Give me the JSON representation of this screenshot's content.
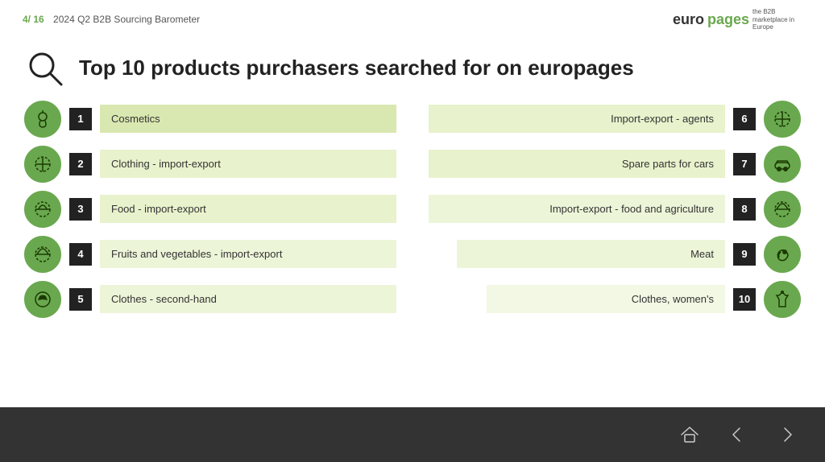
{
  "header": {
    "slide": "4/ 16",
    "title": "2024 Q2 B2B Sourcing Barometer",
    "logo_euro": "euro",
    "logo_pages": "pages",
    "logo_tagline": "the B2B marketplace in Europe"
  },
  "main": {
    "title": "Top 10 products purchasers searched for on europages"
  },
  "left_items": [
    {
      "rank": "1",
      "label": "Cosmetics"
    },
    {
      "rank": "2",
      "label": "Clothing - import-export"
    },
    {
      "rank": "3",
      "label": "Food - import-export"
    },
    {
      "rank": "4",
      "label": "Fruits and vegetables - import-export"
    },
    {
      "rank": "5",
      "label": "Clothes - second-hand"
    }
  ],
  "right_items": [
    {
      "rank": "6",
      "label": "Import-export - agents"
    },
    {
      "rank": "7",
      "label": "Spare parts for cars"
    },
    {
      "rank": "8",
      "label": "Import-export - food and agriculture"
    },
    {
      "rank": "9",
      "label": "Meat"
    },
    {
      "rank": "10",
      "label": "Clothes, women's"
    }
  ],
  "footer": {
    "home_label": "home",
    "prev_label": "previous",
    "next_label": "next"
  }
}
